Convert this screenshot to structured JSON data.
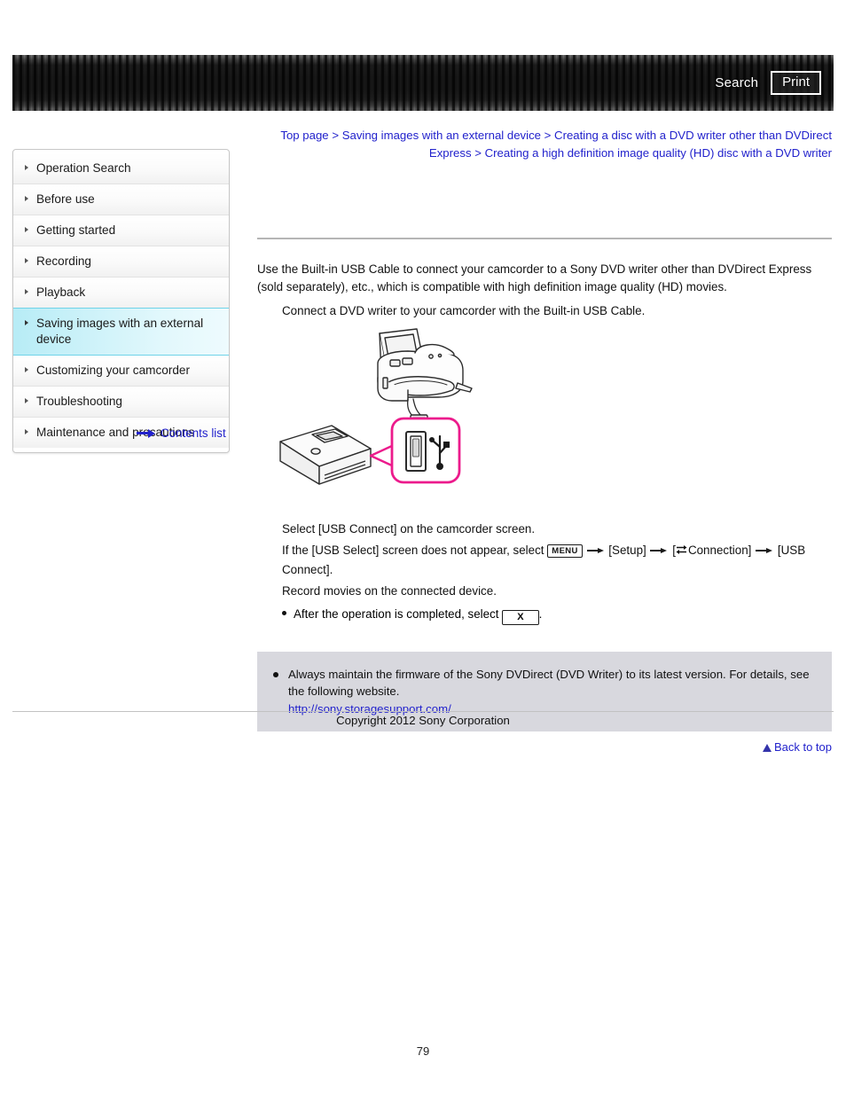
{
  "header": {
    "search_label": "Search",
    "print_label": "Print"
  },
  "breadcrumb": {
    "items": [
      "Top page",
      "Saving images with an external device",
      "Creating a disc with a DVD writer other than DVDirect Express",
      "Creating a high definition image quality (HD) disc with a DVD writer"
    ],
    "separator": ">"
  },
  "sidebar": {
    "items": [
      {
        "label": "Operation Search",
        "active": false
      },
      {
        "label": "Before use",
        "active": false
      },
      {
        "label": "Getting started",
        "active": false
      },
      {
        "label": "Recording",
        "active": false
      },
      {
        "label": "Playback",
        "active": false
      },
      {
        "label": "Saving images with an external device",
        "active": true
      },
      {
        "label": "Customizing your camcorder",
        "active": false
      },
      {
        "label": "Troubleshooting",
        "active": false
      },
      {
        "label": "Maintenance and precautions",
        "active": false
      }
    ],
    "contents_list_label": "Contents list"
  },
  "main": {
    "intro": "Use the Built-in USB Cable to connect your camcorder to a Sony DVD writer other than DVDirect Express (sold separately), etc., which is compatible with high definition image quality (HD) movies.",
    "step1": "Connect a DVD writer to your camcorder with the Built-in USB Cable.",
    "step2": "Select [USB Connect] on the camcorder screen.",
    "step3_a": "If the [USB Select] screen does not appear, select",
    "step3_menu_icon": "MENU",
    "step3_b": "[Setup]",
    "step3_c_prefix": "[",
    "step3_connection": "Connection]",
    "step3_d": "[USB Connect].",
    "step4": "Record movies on the connected device.",
    "step4_bullet_a": "After the operation is completed, select",
    "step4_x_icon": "X",
    "step4_bullet_b": "."
  },
  "note": {
    "text": "Always maintain the firmware of the Sony DVDirect (DVD Writer) to its latest version. For details, see the following website.",
    "url": "http://sony.storagesupport.com/"
  },
  "footer": {
    "back_to_top": "Back to top",
    "copyright": "Copyright 2012 Sony Corporation",
    "page_number": "79"
  }
}
